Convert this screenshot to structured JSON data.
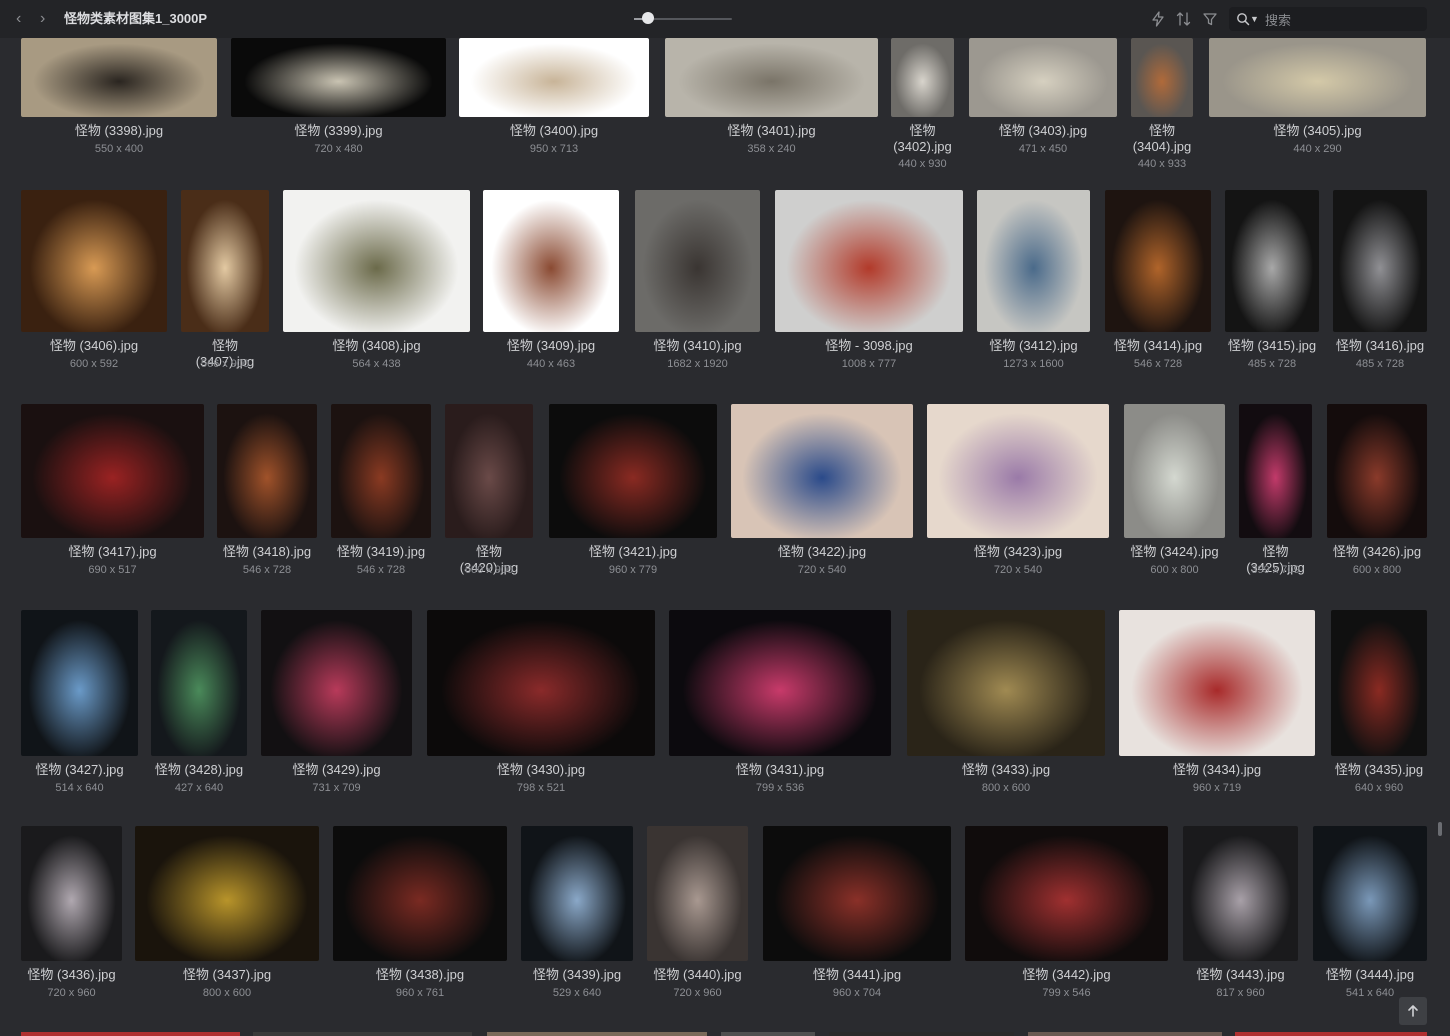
{
  "toolbar": {
    "title": "怪物类素材图集1_3000P",
    "zoom_percent": 14,
    "search_placeholder": "搜索",
    "icons": {
      "back": "chevron-left-icon",
      "forward": "chevron-right-icon",
      "quick": "lightning-icon",
      "sort": "sort-icon",
      "filter": "filter-icon",
      "search": "search-icon"
    }
  },
  "items": [
    {
      "name": "怪物 (3398).jpg",
      "size": "550 x 400",
      "colors": [
        "#a89a82",
        "#2a2520"
      ]
    },
    {
      "name": "怪物 (3399).jpg",
      "size": "720 x 480",
      "colors": [
        "#0a0a0a",
        "#c9c3b2"
      ]
    },
    {
      "name": "怪物 (3400).jpg",
      "size": "950 x 713",
      "colors": [
        "#ffffff",
        "#c8b498"
      ]
    },
    {
      "name": "怪物 (3401).jpg",
      "size": "358 x 240",
      "colors": [
        "#b8b4aa",
        "#7a7468"
      ]
    },
    {
      "name": "怪物 (3402).jpg",
      "size": "440 x 930",
      "colors": [
        "#6e6c68",
        "#d8d4cc"
      ]
    },
    {
      "name": "怪物 (3403).jpg",
      "size": "471 x 450",
      "colors": [
        "#9c9890",
        "#d6d0c0"
      ]
    },
    {
      "name": "怪物 (3404).jpg",
      "size": "440 x 933",
      "colors": [
        "#5a5652",
        "#b06a3a"
      ]
    },
    {
      "name": "怪物 (3405).jpg",
      "size": "440 x 290",
      "colors": [
        "#9a958a",
        "#d4c9a8"
      ]
    },
    {
      "name": "怪物 (3406).jpg",
      "size": "600 x 592",
      "colors": [
        "#3a2110",
        "#d89a54"
      ]
    },
    {
      "name": "怪物 (3407).jpg",
      "size": "566 x 900",
      "colors": [
        "#4a2d18",
        "#e3c9a2"
      ]
    },
    {
      "name": "怪物 (3408).jpg",
      "size": "564 x 438",
      "colors": [
        "#f2f2f0",
        "#6b6a4a"
      ]
    },
    {
      "name": "怪物 (3409).jpg",
      "size": "440 x 463",
      "colors": [
        "#ffffff",
        "#8a4a32"
      ]
    },
    {
      "name": "怪物 (3410).jpg",
      "size": "1682 x 1920",
      "colors": [
        "#6c6b68",
        "#3a3532"
      ]
    },
    {
      "name": "怪物 - 3098.jpg",
      "size": "1008 x 777",
      "colors": [
        "#cfcfce",
        "#b23a2a"
      ]
    },
    {
      "name": "怪物 (3412).jpg",
      "size": "1273 x 1600",
      "colors": [
        "#c6c6c2",
        "#4a6a8a"
      ]
    },
    {
      "name": "怪物 (3414).jpg",
      "size": "546 x 728",
      "colors": [
        "#1e1410",
        "#b0642a"
      ]
    },
    {
      "name": "怪物 (3415).jpg",
      "size": "485 x 728",
      "colors": [
        "#141414",
        "#a8a8a8"
      ]
    },
    {
      "name": "怪物 (3416).jpg",
      "size": "485 x 728",
      "colors": [
        "#141414",
        "#909094"
      ]
    },
    {
      "name": "怪物 (3417).jpg",
      "size": "690 x 517",
      "colors": [
        "#1a1010",
        "#9a2222"
      ]
    },
    {
      "name": "怪物 (3418).jpg",
      "size": "546 x 728",
      "colors": [
        "#1c1210",
        "#a0522a"
      ]
    },
    {
      "name": "怪物 (3419).jpg",
      "size": "546 x 728",
      "colors": [
        "#1c1210",
        "#8a3a22"
      ]
    },
    {
      "name": "怪物 (3420).jpg",
      "size": "600 x 900",
      "colors": [
        "#2a1c1c",
        "#6a4a48"
      ]
    },
    {
      "name": "怪物 (3421).jpg",
      "size": "960 x 779",
      "colors": [
        "#0c0c0c",
        "#8a2a22"
      ]
    },
    {
      "name": "怪物 (3422).jpg",
      "size": "720 x 540",
      "colors": [
        "#d8c4b6",
        "#2a4a8a"
      ]
    },
    {
      "name": "怪物 (3423).jpg",
      "size": "720 x 540",
      "colors": [
        "#e6d8cc",
        "#9a7aa8"
      ]
    },
    {
      "name": "怪物 (3424).jpg",
      "size": "600 x 800",
      "colors": [
        "#8c8c88",
        "#d4d8d0"
      ]
    },
    {
      "name": "怪物 (3425).jpg",
      "size": "399 x 709",
      "colors": [
        "#120c10",
        "#c23a6a"
      ]
    },
    {
      "name": "怪物 (3426).jpg",
      "size": "600 x 800",
      "colors": [
        "#140c0c",
        "#8a3a2a"
      ]
    },
    {
      "name": "怪物 (3427).jpg",
      "size": "514 x 640",
      "colors": [
        "#101418",
        "#6a9ac8"
      ]
    },
    {
      "name": "怪物 (3428).jpg",
      "size": "427 x 640",
      "colors": [
        "#14181c",
        "#4a8a5a"
      ]
    },
    {
      "name": "怪物 (3429).jpg",
      "size": "731 x 709",
      "colors": [
        "#121012",
        "#b83a5a"
      ]
    },
    {
      "name": "怪物 (3430).jpg",
      "size": "798 x 521",
      "colors": [
        "#0c0a0a",
        "#8a2a2a"
      ]
    },
    {
      "name": "怪物 (3431).jpg",
      "size": "799 x 536",
      "colors": [
        "#0c0a0e",
        "#c83a6a"
      ]
    },
    {
      "name": "怪物 (3433).jpg",
      "size": "800 x 600",
      "colors": [
        "#2a2418",
        "#a08a52"
      ]
    },
    {
      "name": "怪物 (3434).jpg",
      "size": "960 x 719",
      "colors": [
        "#e8e2de",
        "#a82a2a"
      ]
    },
    {
      "name": "怪物 (3435).jpg",
      "size": "640 x 960",
      "colors": [
        "#101010",
        "#8a2a22"
      ]
    },
    {
      "name": "怪物 (3436).jpg",
      "size": "720 x 960",
      "colors": [
        "#1a1a1c",
        "#b0a8b0"
      ]
    },
    {
      "name": "怪物 (3437).jpg",
      "size": "800 x 600",
      "colors": [
        "#1a140c",
        "#b8942a"
      ]
    },
    {
      "name": "怪物 (3438).jpg",
      "size": "960 x 761",
      "colors": [
        "#0c0c0c",
        "#7a2a22"
      ]
    },
    {
      "name": "怪物 (3439).jpg",
      "size": "529 x 640",
      "colors": [
        "#101418",
        "#8aa8c8"
      ]
    },
    {
      "name": "怪物 (3440).jpg",
      "size": "720 x 960",
      "colors": [
        "#3a3432",
        "#a89890"
      ]
    },
    {
      "name": "怪物 (3441).jpg",
      "size": "960 x 704",
      "colors": [
        "#0c0c0c",
        "#8a3028"
      ]
    },
    {
      "name": "怪物 (3442).jpg",
      "size": "799 x 546",
      "colors": [
        "#100c0c",
        "#a03030"
      ]
    },
    {
      "name": "怪物 (3443).jpg",
      "size": "817 x 960",
      "colors": [
        "#1a1a1c",
        "#a8a0a8"
      ]
    },
    {
      "name": "怪物 (3444).jpg",
      "size": "541 x 640",
      "colors": [
        "#101418",
        "#7a98b8"
      ]
    }
  ],
  "row_colors": [
    "#b03030",
    "#3a3a3a",
    "#7a6a5a",
    "#505050",
    "#2a2a2a",
    "#6a5a52"
  ]
}
